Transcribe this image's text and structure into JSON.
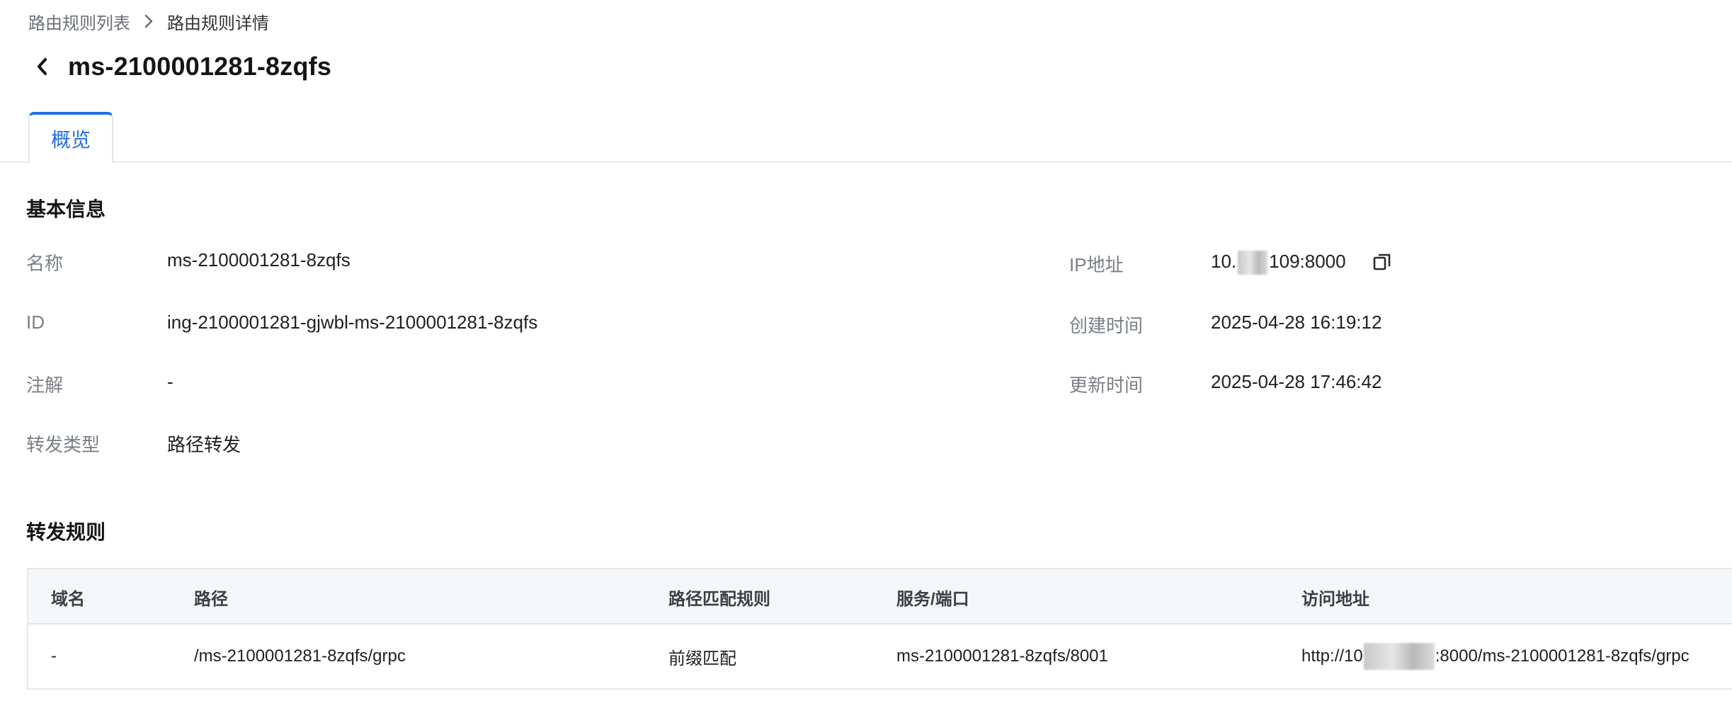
{
  "breadcrumb": {
    "parent": "路由规则列表",
    "current": "路由规则详情"
  },
  "header": {
    "title": "ms-2100001281-8zqfs"
  },
  "tabs": [
    {
      "label": "概览",
      "active": true
    }
  ],
  "basic_info": {
    "section_title": "基本信息",
    "left": [
      {
        "label": "名称",
        "value": "ms-2100001281-8zqfs"
      },
      {
        "label": "ID",
        "value": "ing-2100001281-gjwbl-ms-2100001281-8zqfs"
      },
      {
        "label": "注解",
        "value": "-"
      },
      {
        "label": "转发类型",
        "value": "路径转发"
      }
    ],
    "right": [
      {
        "label": "IP地址",
        "value_prefix": "10.",
        "value_suffix": "109:8000",
        "icon": "copy-icon"
      },
      {
        "label": "创建时间",
        "value": "2025-04-28 16:19:12"
      },
      {
        "label": "更新时间",
        "value": "2025-04-28 17:46:42"
      }
    ]
  },
  "forward_rules": {
    "section_title": "转发规则",
    "columns": [
      "域名",
      "路径",
      "路径匹配规则",
      "服务/端口",
      "访问地址"
    ],
    "rows": [
      {
        "domain": "-",
        "path": "/ms-2100001281-8zqfs/grpc",
        "match_rule": "前缀匹配",
        "service_port": "ms-2100001281-8zqfs/8001",
        "url_prefix": "http://10",
        "url_suffix": ":8000/ms-2100001281-8zqfs/grpc"
      }
    ]
  },
  "colors": {
    "accent": "#1f6fe5",
    "label": "#7a7f87",
    "text": "#1f1f1f",
    "table_header_bg": "#f5f6f8",
    "border": "#e6e8ec"
  }
}
